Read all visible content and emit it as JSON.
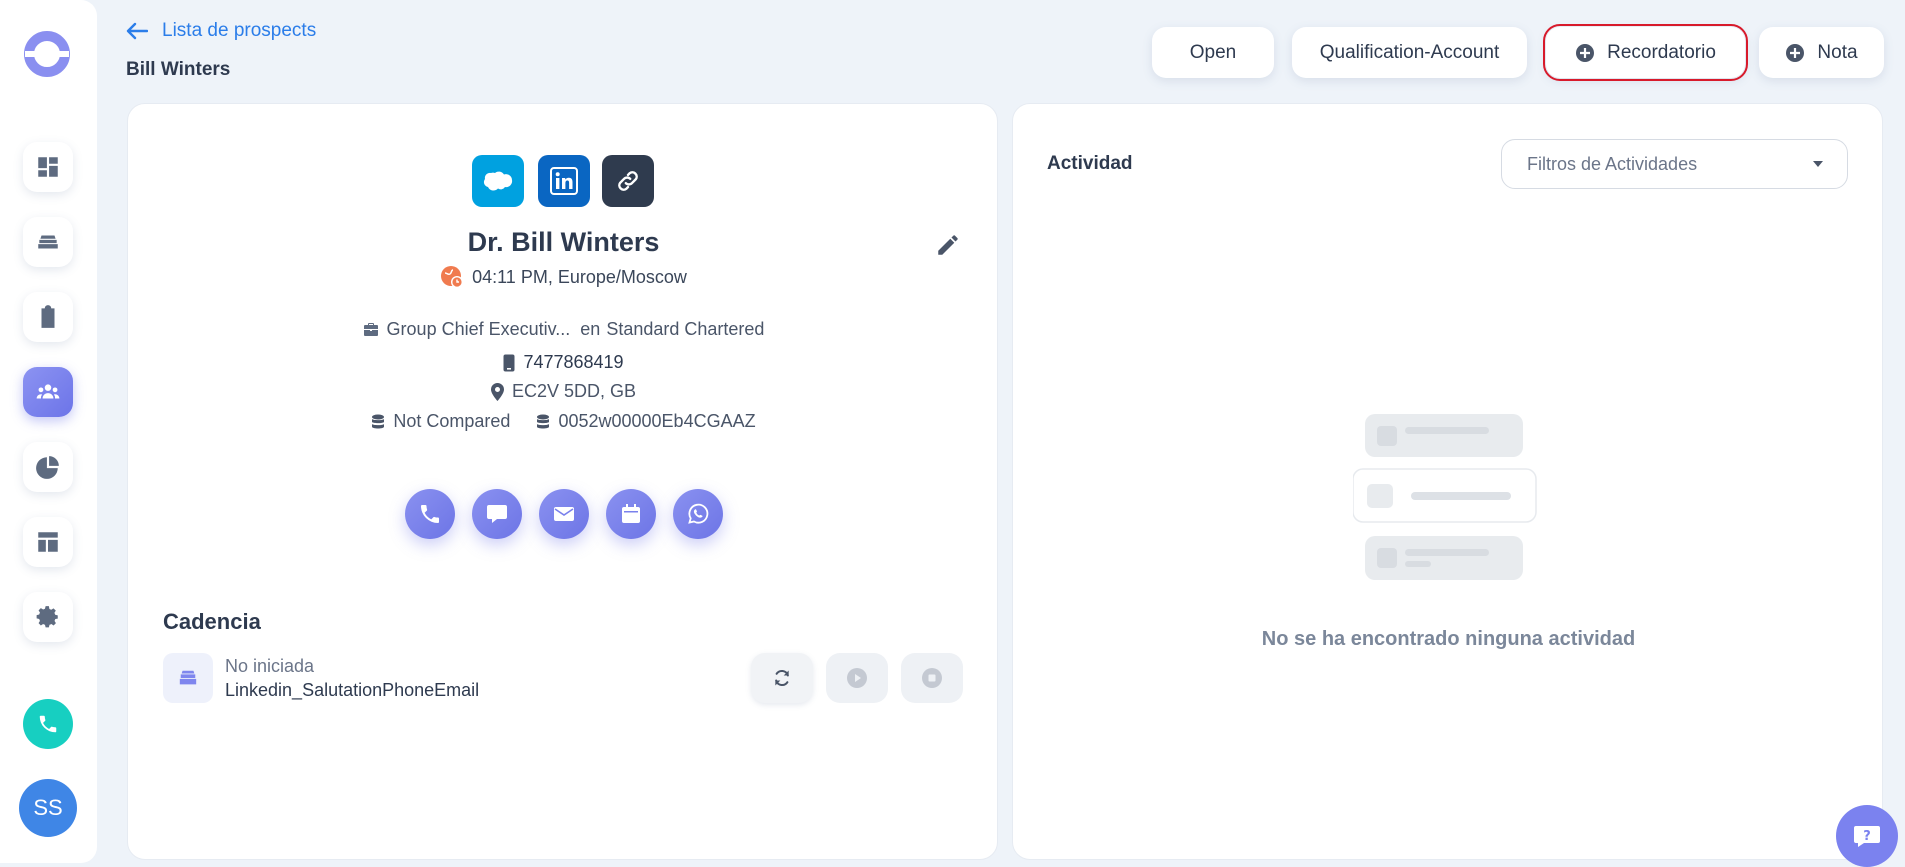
{
  "header": {
    "back_label": "Lista de prospects",
    "page_title": "Bill Winters",
    "buttons": {
      "open": "Open",
      "stage": "Qualification-Account",
      "reminder": "Recordatorio",
      "note": "Nota"
    }
  },
  "sidebar": {
    "avatar_initials": "SS",
    "items": [
      "dashboard-icon",
      "cadences-icon",
      "tasks-icon",
      "prospects-icon",
      "reports-icon",
      "templates-icon",
      "settings-icon"
    ]
  },
  "prospect": {
    "full_name": "Dr. Bill Winters",
    "local_time": "04:11 PM, Europe/Moscow",
    "job_title": "Group Chief Executiv...",
    "company_prefix": "en",
    "company": "Standard Chartered",
    "phone": "7477868419",
    "location": "EC2V 5DD, GB",
    "crm_status": "Not Compared",
    "crm_id": "0052w00000Eb4CGAAZ"
  },
  "cadence": {
    "title": "Cadencia",
    "status": "No iniciada",
    "name": "Linkedin_SalutationPhoneEmail"
  },
  "activity": {
    "title": "Actividad",
    "filter_placeholder": "Filtros de Actividades",
    "empty_message": "No se ha encontrado ninguna actividad"
  },
  "colors": {
    "accent": "#6c74e8",
    "link": "#2b7de9",
    "highlight_outline": "#d81a2b",
    "salesforce": "#00a1e0",
    "linkedin": "#0a66c2",
    "teal": "#17cfc1"
  }
}
